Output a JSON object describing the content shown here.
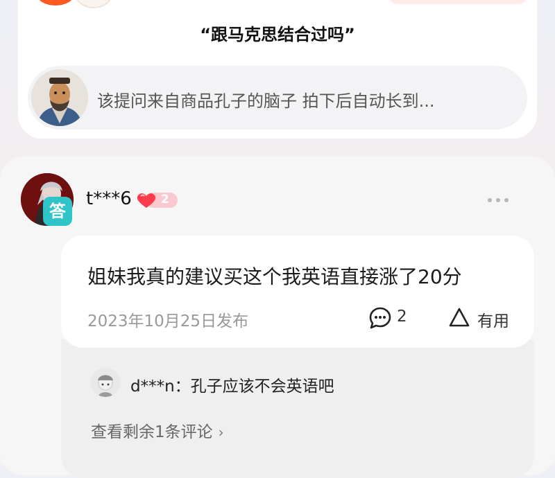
{
  "question": {
    "text": "“跟马克思结合过吗”",
    "source_text": "该提问来自商品孔子的脑子 拍下后自动长到..."
  },
  "answer": {
    "badge": "答",
    "username": "t***6",
    "level": "2",
    "text": "姐妹我真的建议买这个我英语直接涨了20分",
    "date": "2023年10月25日发布",
    "comment_count": "2",
    "useful_label": "有用"
  },
  "reply": {
    "text": "d***n：孔子应该不会英语吧",
    "view_more": "查看剩余1条评论"
  },
  "colors": {
    "accent_orange": "#ff5a1f",
    "badge_teal": "#2ec4c8",
    "heart_red": "#ff3b4e"
  },
  "icons": [
    "comment-icon",
    "useful-icon",
    "more-icon",
    "chevron-right-icon",
    "heart-level-icon"
  ]
}
